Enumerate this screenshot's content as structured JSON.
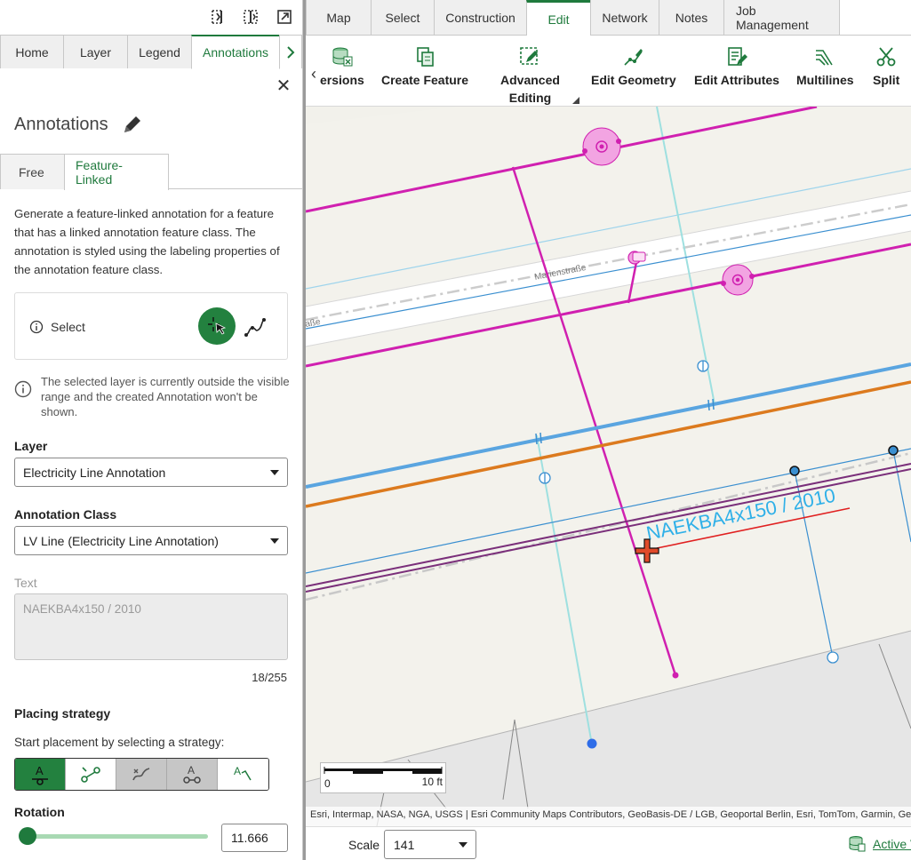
{
  "left_panel": {
    "tabs": [
      {
        "label": "Home"
      },
      {
        "label": "Layer"
      },
      {
        "label": "Legend"
      },
      {
        "label": "Annotations",
        "active": true
      }
    ],
    "title": "Annotations",
    "sub_tabs": [
      {
        "label": "Free"
      },
      {
        "label": "Feature-Linked",
        "active": true
      }
    ],
    "description": "Generate a feature-linked annotation for a feature that has a linked annotation feature class. The annotation is styled using the labeling properties of the annotation feature class.",
    "select_label": "Select",
    "warning": "The selected layer is currently outside the visible range and the created Annotation won't be shown.",
    "layer": {
      "label": "Layer",
      "value": "Electricity Line Annotation"
    },
    "annotation_class": {
      "label": "Annotation Class",
      "value": "LV Line (Electricity Line Annotation)"
    },
    "text": {
      "label": "Text",
      "placeholder": "NAEKBA4x150 / 2010"
    },
    "counter": "18/255",
    "placing_strategy": {
      "label": "Placing strategy",
      "hint": "Start placement by selecting a strategy:"
    },
    "rotation": {
      "label": "Rotation",
      "value": "11.666",
      "fraction": 0.0
    }
  },
  "top_tabs": [
    {
      "label": "Map"
    },
    {
      "label": "Select"
    },
    {
      "label": "Construction"
    },
    {
      "label": "Edit",
      "active": true
    },
    {
      "label": "Network"
    },
    {
      "label": "Notes"
    },
    {
      "label": "Job Management"
    }
  ],
  "ribbon": {
    "versions": "ersions",
    "create_feature": "Create Feature",
    "advanced_editing_1": "Advanced",
    "advanced_editing_2": "Editing",
    "edit_geometry": "Edit Geometry",
    "edit_attributes": "Edit Attributes",
    "multilines": "Multilines",
    "split": "Split"
  },
  "map": {
    "street_1": "Marienstraße",
    "street_2": "aße",
    "annotation_text": "NAEKBA4x150 / 2010",
    "attribution": "Esri, Intermap, NASA, NGA, USGS | Esri Community Maps Contributors, GeoBasis-DE / LGB, Geoportal Berlin, Esri, TomTom, Garmin, Geo",
    "scalebar_start": "0",
    "scalebar_end": "10 ft"
  },
  "status_bar": {
    "scale_label": "Scale",
    "scale_value": "141",
    "active_version": "Active V"
  },
  "colors": {
    "accent": "#1f7a3d",
    "magenta": "#d020b0",
    "blue_line": "#5aa5e0",
    "orange_line": "#dc7a1e",
    "purple_line": "#7a2f7a",
    "annotation": "#2fb0e8"
  }
}
